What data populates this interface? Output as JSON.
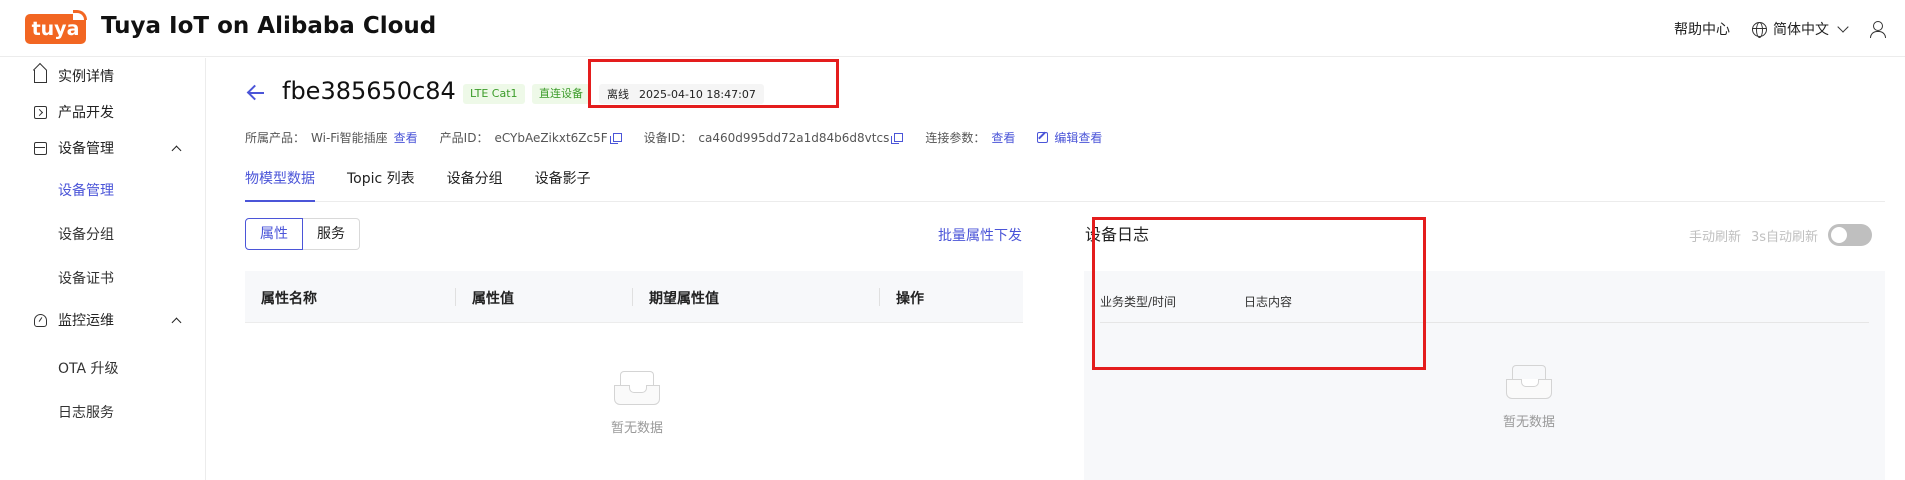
{
  "header": {
    "logo_text": "tuya",
    "app_title": "Tuya IoT on Alibaba Cloud",
    "help_label": "帮助中心",
    "language_label": "简体中文"
  },
  "sidebar": {
    "items": [
      {
        "label": "实例详情",
        "icon": "home-icon"
      },
      {
        "label": "产品开发",
        "icon": "product-icon"
      },
      {
        "label": "设备管理",
        "icon": "device-grid-icon",
        "expanded": true,
        "children": [
          {
            "label": "设备管理",
            "active": true
          },
          {
            "label": "设备分组"
          },
          {
            "label": "设备证书"
          }
        ]
      },
      {
        "label": "监控运维",
        "icon": "monitor-icon",
        "expanded": true,
        "children": [
          {
            "label": "OTA 升级"
          },
          {
            "label": "日志服务"
          }
        ]
      }
    ]
  },
  "device": {
    "name": "fbe385650c84",
    "tags": [
      "LTE Cat1",
      "直连设备"
    ],
    "status": "离线",
    "timestamp": "2025-04-10 18:47:07"
  },
  "meta": {
    "product_key": "所属产品：",
    "product_value": "Wi-Fi智能插座",
    "product_link": "查看",
    "product_id_key": "产品ID：",
    "product_id_value": "eCYbAeZikxt6Zc5F",
    "device_id_key": "设备ID：",
    "device_id_value": "ca460d995dd72a1d84b6d8vtcs",
    "conn_key": "连接参数：",
    "conn_link": "查看",
    "edit_link": "编辑查看"
  },
  "tabs": [
    "物模型数据",
    "Topic 列表",
    "设备分组",
    "设备影子"
  ],
  "active_tab": 0,
  "segment": {
    "options": [
      "属性",
      "服务"
    ],
    "active": 0
  },
  "batch_link": "批量属性下发",
  "table": {
    "columns": [
      "属性名称",
      "属性值",
      "期望属性值",
      "操作"
    ],
    "empty_text": "暂无数据"
  },
  "log": {
    "title": "设备日志",
    "manual_refresh": "手动刷新",
    "auto_refresh": "3s自动刷新",
    "auto_refresh_on": false,
    "columns": [
      "业务类型/时间",
      "日志内容"
    ],
    "empty_text": "暂无数据"
  },
  "colors": {
    "brand": "#f26622",
    "accent": "#4b55d8",
    "annotation": "#e41d1d",
    "tag_green": "#3c9c2a"
  }
}
